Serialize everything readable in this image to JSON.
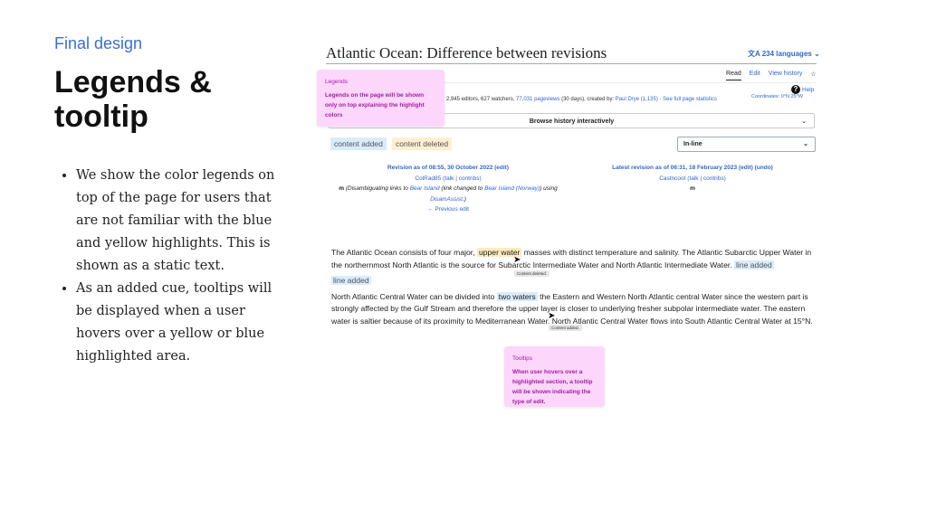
{
  "slide": {
    "kicker": "Final design",
    "heading": "Legends & tooltip",
    "bullets": [
      "We show the color legends on top of the page for users that are not familiar with the blue and yellow highlights. This is shown as a static text.",
      "As an added cue, tooltips will be displayed when a user hovers over a yellow or blue highlighted area."
    ]
  },
  "wiki": {
    "title": "Atlantic Ocean: Difference between revisions",
    "languages": "234 languages",
    "tabs": [
      "Read",
      "Edit",
      "View history"
    ],
    "stats_prefix": "2,945 editors, 627 watchers, ",
    "pageviews": "77,031 pageviews",
    "stats_mid": " (30 days), created by: ",
    "creator": "Paul Drye",
    "creator_count": " (1,135)",
    "stats_sep": " · ",
    "full_stats": "See full page statistics",
    "coordinates": "Coordinates: 0°N 25°W",
    "help": "Help",
    "browse": "Browse history interactively",
    "legend_added": "content added",
    "legend_deleted": "content deleted",
    "view_mode": "In-line",
    "left_rev": {
      "header": "Revision as of 08:55, 30 October 2022 (edit)",
      "user": "ColRad85",
      "user_links": "(talk | contribs)",
      "minor": "m",
      "summary_1": " (Disambiguating links to ",
      "link1": "Bear Island",
      "summary_2": " (link changed to ",
      "link2": "Bear Island (Norway)",
      "summary_3": ") using ",
      "link3": "DisamAssist",
      "summary_4": ".)",
      "prev": "← Previous edit"
    },
    "right_rev": {
      "header": "Latest revision as of 06:31, 18 February 2023 (edit) (undo)",
      "user": "Castncoot",
      "user_links": "(talk | contribs)",
      "minor": "m"
    },
    "body": {
      "p1_a": "The Atlantic Ocean consists of four major, ",
      "p1_del": "upper water",
      "p1_b": " masses with distinct temperature and salinity. The Atlantic Subarctic Upper Water in the northernmost North Atlantic is the source for Subarctic Intermediate Water and North Atlantic Intermediate Water. ",
      "p1_add": "line added",
      "line_added": "line added",
      "p2_a": "North Atlantic Central Water can be divided into ",
      "p2_add": "two waters",
      "p2_b": " the Eastern and Western North Atlantic central Water since the western part is strongly affected by the Gulf Stream and therefore the upper layer is closer to underlying fresher subpolar intermediate water. The eastern water is saltier because of its proximity to Mediterranean Water. North Atlantic Central Water flows into South Atlantic Central Water at 15°N.",
      "tip_deleted": "Content deleted.",
      "tip_added": "Content added."
    }
  },
  "callouts": {
    "legends_title": "Legends",
    "legends_text": "Legends on the page will be shown only on top explaining the highlight colors",
    "tooltips_title": "Tooltips",
    "tooltips_text": "When user hovers over a highlighted section, a tooltip will be shown indicating the type of edit."
  },
  "colors": {
    "accent": "#3366cc",
    "added": "#d9ecfb",
    "deleted": "#fdecc0",
    "callout": "#fdd6fb"
  }
}
